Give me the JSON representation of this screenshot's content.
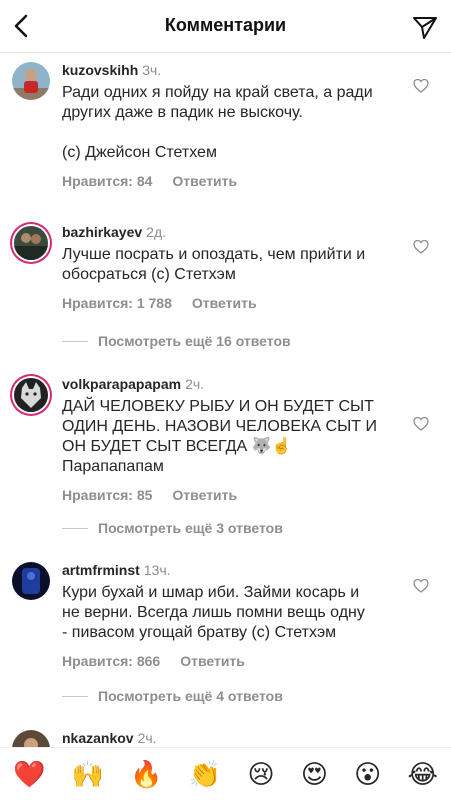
{
  "header": {
    "title": "Комментарии",
    "back_icon": "chevron-left-icon",
    "send_icon": "paper-plane-icon"
  },
  "comments": [
    {
      "user": "kuzovskihh",
      "time": "3ч.",
      "text": "Ради одних я пойду на край света, а ради\nдругих даже в падик не выскочу.\n\n(с) Джейсон Стетхем",
      "likes": "Нравится: 84",
      "reply": "Ответить"
    },
    {
      "user": "bazhirkayev",
      "time": "2д.",
      "text": "Лучше посрать и опоздать, чем прийти и\nобосраться (с) Стетхэм",
      "likes": "Нравится: 1 788",
      "reply": "Ответить",
      "more": "Посмотреть ещё 16 ответов"
    },
    {
      "user": "volkparapapapam",
      "time": "2ч.",
      "text": "ДАЙ ЧЕЛОВЕКУ РЫБУ И ОН БУДЕТ СЫТ\nОДИН ДЕНЬ. НАЗОВИ ЧЕЛОВЕКА СЫТ И\nОН БУДЕТ СЫТ ВСЕГДА 🐺☝️\nПарапапапам",
      "likes": "Нравится: 85",
      "reply": "Ответить",
      "more": "Посмотреть ещё 3 ответов"
    },
    {
      "user": "artmfrminst",
      "time": "13ч.",
      "text": "Кури бухай и шмар иби. Займи косарь и\nне верни. Всегда лишь помни вещь одну\n- пивасом угощай братву (с) Стетхэм",
      "likes": "Нравится: 866",
      "reply": "Ответить",
      "more": "Посмотреть ещё 4 ответов"
    },
    {
      "user": "nkazankov",
      "time": "2ч."
    }
  ],
  "emojis": [
    "❤️",
    "🙌",
    "🔥",
    "👏",
    "😢",
    "😍",
    "😮",
    "😂"
  ]
}
